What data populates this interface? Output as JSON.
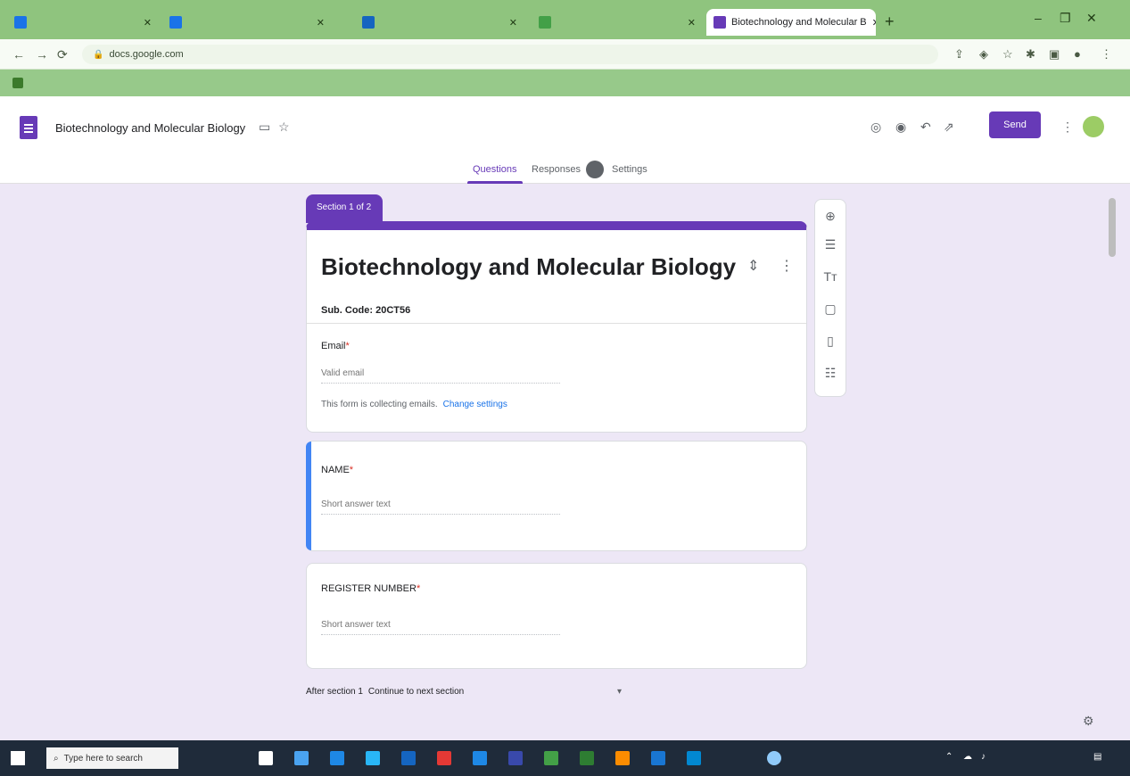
{
  "browser": {
    "tabs": [
      {
        "label": "",
        "color": "#1a73e8"
      },
      {
        "label": "",
        "color": "#1a73e8"
      },
      {
        "label": "",
        "color": "#1565c0"
      },
      {
        "label": "",
        "color": "#43a047"
      },
      {
        "label": "Biotechnology and Molecular B",
        "color": "#673ab7",
        "active": true
      }
    ],
    "new_tab": "+",
    "window_controls": [
      "–",
      "❐",
      "✕"
    ],
    "url": "docs.google.com",
    "bookmark": ""
  },
  "header": {
    "doc_title": "Biotechnology and Molecular Biology",
    "send_label": "Send",
    "avatar_letter": "",
    "tabs": {
      "questions": "Questions",
      "responses": "Responses",
      "settings": "Settings"
    },
    "responses_badge": "",
    "total_points": ""
  },
  "form": {
    "section_tag": "Section 1 of 2",
    "title": "Biotechnology and Molecular Biology",
    "description": "Sub. Code: 20CT56",
    "email_label": "Email",
    "email_placeholder": "Valid email",
    "collect_note": "This form is collecting emails.",
    "collect_link": "Change settings",
    "questions": [
      {
        "label": "NAME",
        "placeholder": "Short answer text"
      },
      {
        "label": "REGISTER NUMBER",
        "placeholder": "Short answer text"
      }
    ],
    "required_mark": "*",
    "after_section": "After section 1",
    "after_section_value": "Continue to next section"
  },
  "icons": {
    "palette": "palette-icon",
    "preview": "eye-icon",
    "undo": "undo-icon",
    "redo": "redo-icon",
    "more": "more-vert-icon"
  },
  "accent": "#673ab7",
  "taskbar": {
    "search_placeholder": "Type here to search",
    "weather": "",
    "time": "",
    "date": ""
  }
}
